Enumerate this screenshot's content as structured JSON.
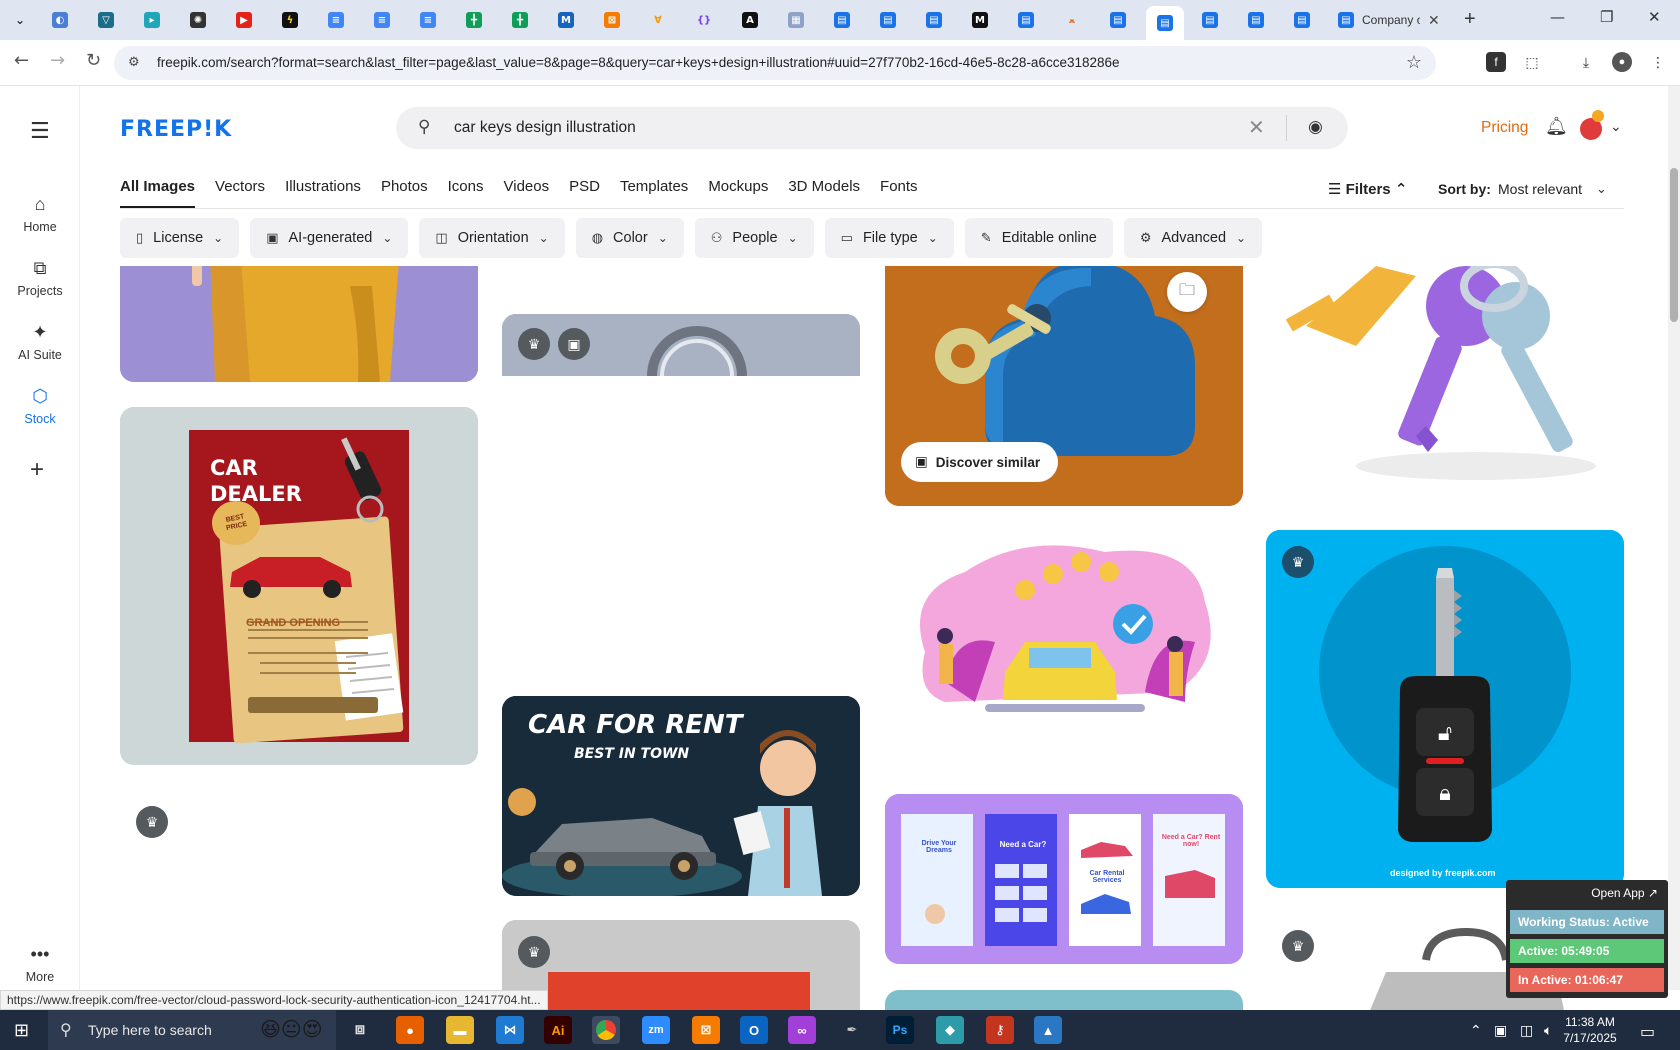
{
  "browser": {
    "active_tab_title": "Company o",
    "url": "freepik.com/search?format=search&last_filter=page&last_value=8&page=8&query=car+keys+design+illustration#uuid=27f770b2-16cd-46e5-8c28-a6cce318286e",
    "status_url": "https://www.freepik.com/free-vector/cloud-password-lock-security-authentication-icon_12417704.ht..."
  },
  "rail": {
    "items": [
      {
        "label": "Home",
        "icon": "home-icon"
      },
      {
        "label": "Projects",
        "icon": "projects-icon"
      },
      {
        "label": "AI Suite",
        "icon": "sparkle-icon"
      },
      {
        "label": "Stock",
        "icon": "stock-icon"
      }
    ],
    "more_label": "More"
  },
  "header": {
    "logo": "FREEP!K",
    "search_value": "car keys design illustration",
    "pricing": "Pricing"
  },
  "categories": [
    "All Images",
    "Vectors",
    "Illustrations",
    "Photos",
    "Icons",
    "Videos",
    "PSD",
    "Templates",
    "Mockups",
    "3D Models",
    "Fonts"
  ],
  "filters_label": "Filters",
  "sort": {
    "label": "Sort by:",
    "value": "Most relevant"
  },
  "chips": [
    "License",
    "AI-generated",
    "Orientation",
    "Color",
    "People",
    "File type",
    "Editable online",
    "Advanced"
  ],
  "grid": {
    "discover_label": "Discover similar",
    "car_dealer": {
      "title_1": "CAR",
      "title_2": "DEALER",
      "best_price": "BEST PRICE",
      "grand_opening": "GRAND OPENING"
    },
    "car_for_rent": {
      "title": "CAR FOR RENT",
      "subtitle": "BEST IN TOWN"
    },
    "rental_cards": [
      "Drive Your Dreams",
      "Need a Car?",
      "Car Rental Services",
      "Need a Car? Rent now!"
    ],
    "watermark": "designed by freepik.com"
  },
  "widget": {
    "open_app": "Open App ↗",
    "status": "Working Status: Active",
    "active": "Active: 05:49:05",
    "inactive": "In Active: 01:06:47"
  },
  "taskbar": {
    "search_placeholder": "Type here to search",
    "time": "11:38 AM",
    "date": "7/17/2025"
  }
}
